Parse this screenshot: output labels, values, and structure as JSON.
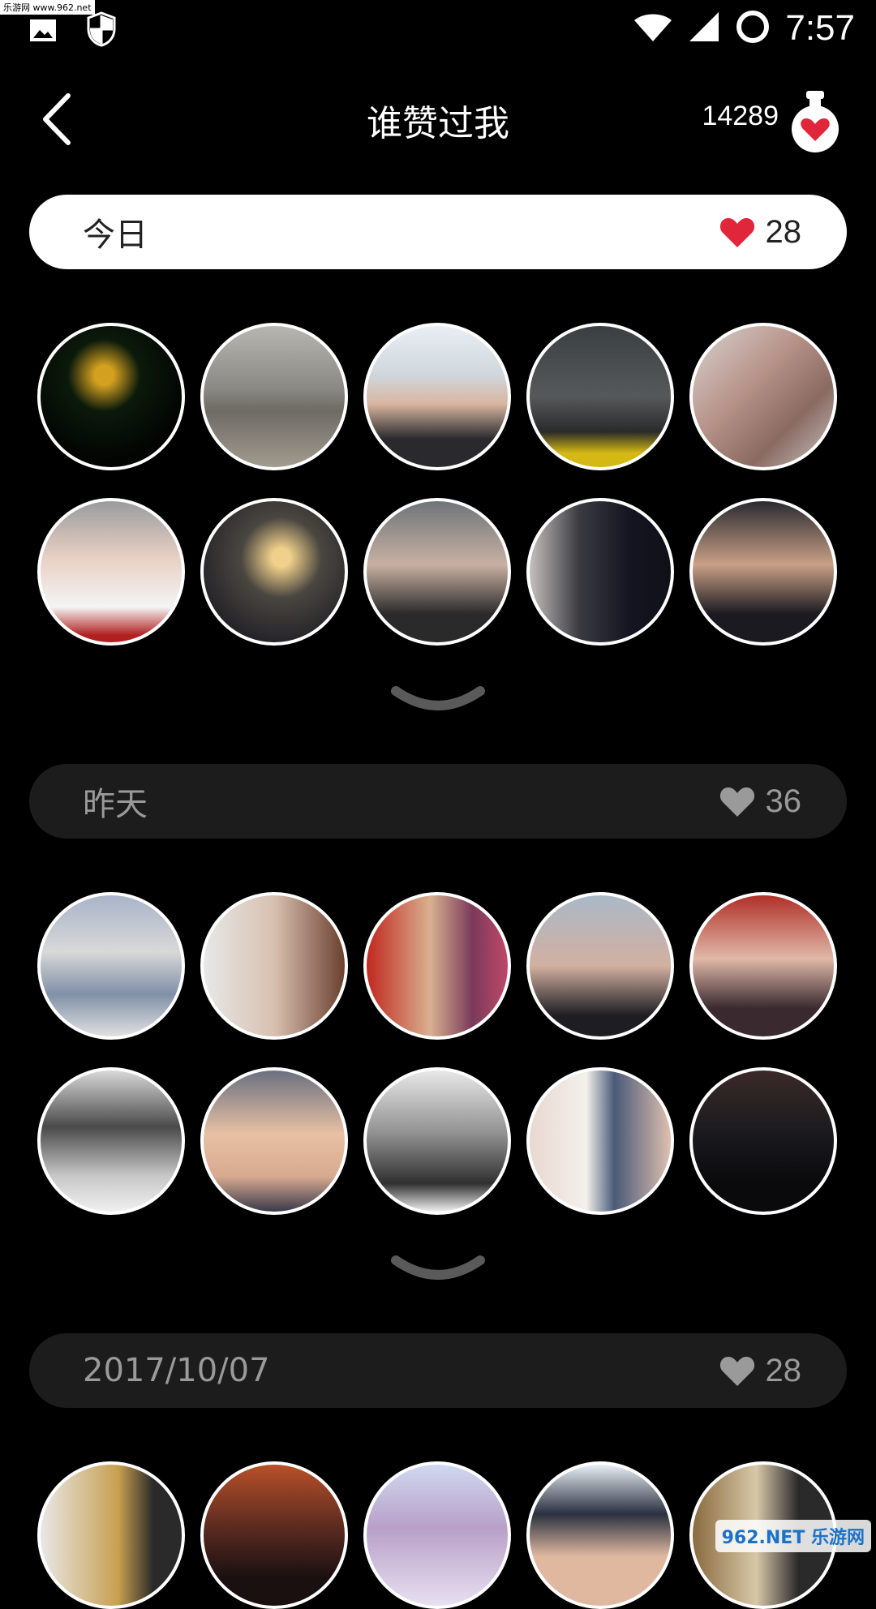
{
  "status_bar": {
    "watermark": "乐游网 www.962.net",
    "time": "7:57",
    "icons": [
      "image-icon",
      "shield-icon",
      "wifi-icon",
      "signal-icon",
      "battery-ring-icon"
    ]
  },
  "header": {
    "title": "谁赞过我",
    "points": "14289",
    "back_icon": "chevron-left-icon",
    "potion_icon": "heart-potion-icon"
  },
  "sections": [
    {
      "label": "今日",
      "count": "28",
      "active": true,
      "avatars": [
        {
          "bg": "radial-gradient(circle at 45% 35%, #d4a020 0 8%, #0b1a0b 30%, #020402 70%)"
        },
        {
          "bg": "linear-gradient(180deg, #b8b6b0 0%, #8a8884 45%, #6e6a64 60%, #a29b8f 100%)"
        },
        {
          "bg": "linear-gradient(180deg, #e8eef4 0%, #cfd6dc 35%, #d9b6a0 55%, #2a2a2e 80%)"
        },
        {
          "bg": "linear-gradient(180deg, #3a3f40 0%, #55595a 50%, #2a2a2a 75%, #d4b814 90%)"
        },
        {
          "bg": "linear-gradient(135deg, #d8d4d0 0%, #b8948a 40%, #8a6a62 70%, #c9c4c0 100%)"
        }
      ],
      "avatars2": [
        {
          "bg": "linear-gradient(180deg, #9a9c9e 0%, #e8d0c4 40%, #f4f4f4 75%, #b02020 95%)"
        },
        {
          "bg": "radial-gradient(circle at 55% 40%, #f0d08a 0 8%, #4a4640 35%, #1e1e24 80%)"
        },
        {
          "bg": "linear-gradient(180deg, #6f757a 0%, #c8b0a2 45%, #2a2a2a 80%)"
        },
        {
          "bg": "linear-gradient(90deg, #c4c0bc 0%, #3a3a40 35%, #151522 70%, #101018 100%)"
        },
        {
          "bg": "linear-gradient(180deg, #2a2a30 0%, #c9a086 45%, #1a1a20 80%)"
        }
      ]
    },
    {
      "label": "昨天",
      "count": "36",
      "active": false,
      "avatars": [
        {
          "bg": "linear-gradient(180deg, #a8b4c8 0%, #d8d8d8 40%, #8090a8 70%, #e0e0e0 100%)"
        },
        {
          "bg": "linear-gradient(90deg, #e8e8e8 0%, #d8c0b0 50%, #6a4030 100%)"
        },
        {
          "bg": "linear-gradient(90deg, #c0281e 0%, #d8b090 45%, #7a3a5a 75%, #c04868 100%)"
        },
        {
          "bg": "linear-gradient(180deg, #aab8c8 0%, #d2b0a0 50%, #1e1e22 85%)"
        },
        {
          "bg": "linear-gradient(180deg, #b03028 0%, #e0b8a8 45%, #3a2a30 80%)"
        }
      ],
      "avatars2": [
        {
          "bg": "linear-gradient(180deg, #d8d8d8 0%, #4a4a4a 40%, #c8c8c8 75%, #f0f0f0 100%)"
        },
        {
          "bg": "linear-gradient(180deg, #6a7080 0%, #e8c0a4 45%, #d8aa90 75%, #3a3a4a 100%)"
        },
        {
          "bg": "linear-gradient(180deg, #e8e8e8 0%, #909090 45%, #303030 80%, #f0f0f0 100%)"
        },
        {
          "bg": "linear-gradient(90deg, #e8d8d0 0%, #f4f0ec 40%, #4a5a78 60%, #e0c0b0 100%)"
        },
        {
          "bg": "linear-gradient(180deg, #3a2a28 0%, #1a1a1e 45%, #0a0a0c 80%)"
        }
      ]
    },
    {
      "label": "2017/10/07",
      "count": "28",
      "active": false,
      "avatars": [
        {
          "bg": "linear-gradient(90deg, #e8e8e8 0%, #c8a050 55%, #2a2a2a 80%)"
        },
        {
          "bg": "linear-gradient(180deg, #b85028 0%, #5a2a20 45%, #1a1010 80%)"
        },
        {
          "bg": "linear-gradient(180deg, #d0d8f0 0%, #b8a0c8 45%, #e8e0f0 100%)"
        },
        {
          "bg": "linear-gradient(180deg, #e8eef4 0%, #2a3040 35%, #e0b8a0 65%)"
        },
        {
          "bg": "linear-gradient(90deg, #8a6a40 0%, #d8c8a8 45%, #2a2a2a 75%)"
        }
      ],
      "avatars2": []
    }
  ],
  "watermark_bottom": "962.NET 乐游网"
}
